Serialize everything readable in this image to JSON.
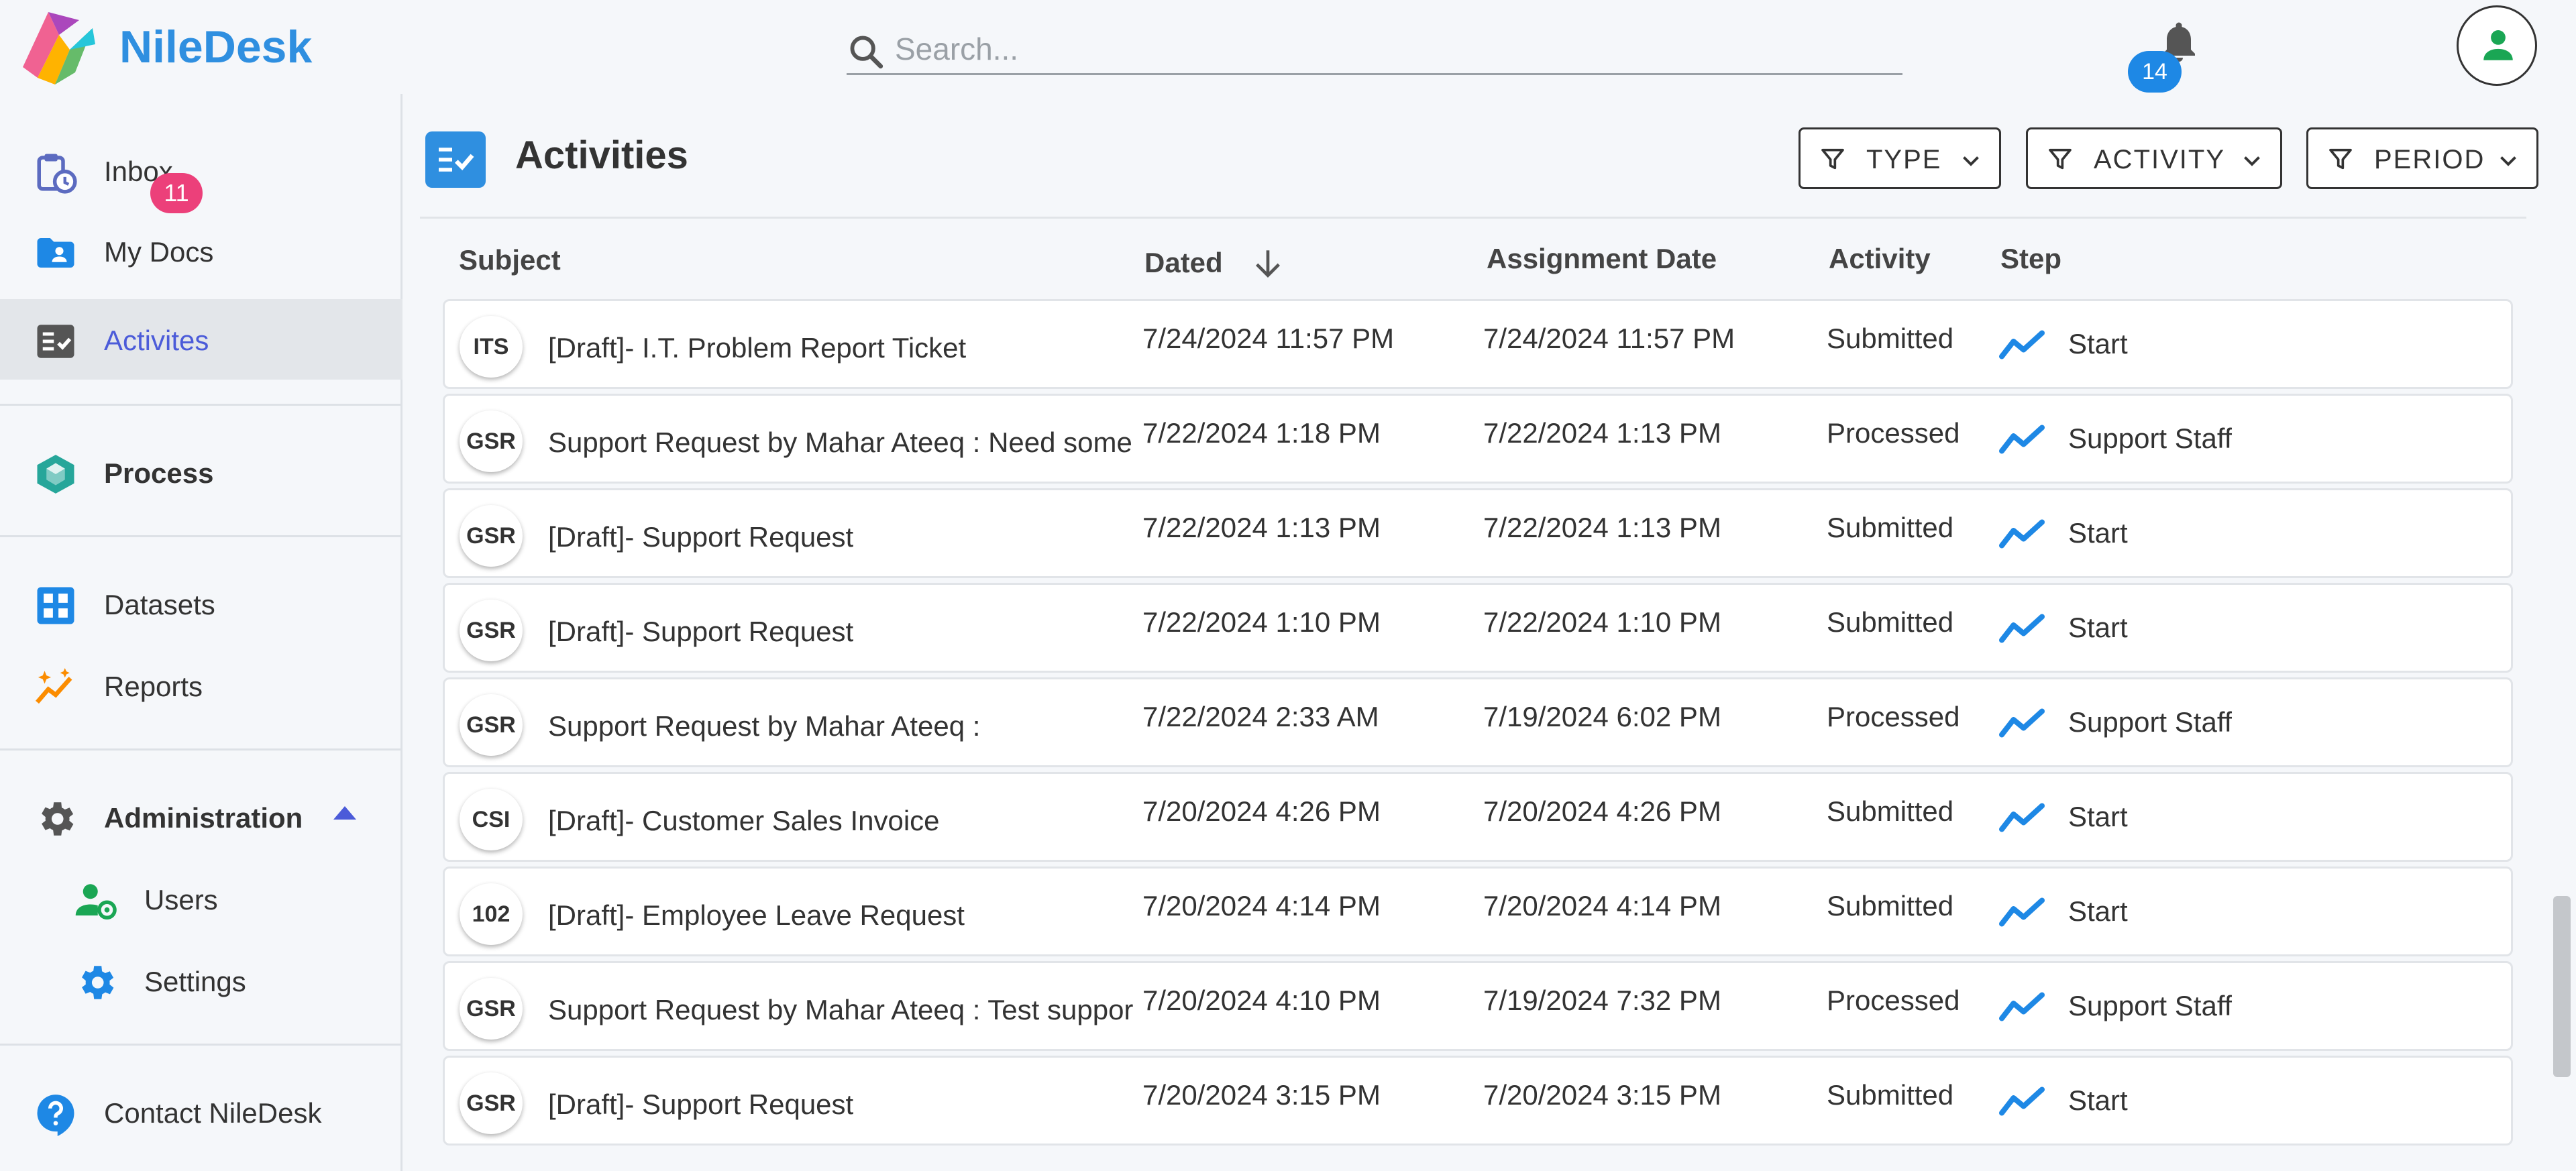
{
  "header": {
    "brand": "NileDesk",
    "search_placeholder": "Search...",
    "notification_count": "14"
  },
  "sidebar": {
    "items": [
      {
        "label": "Inbox",
        "icon": "clipboard-clock-icon",
        "badge": "11"
      },
      {
        "label": "My Docs",
        "icon": "folder-user-icon"
      },
      {
        "label": "Activites",
        "icon": "checklist-icon"
      },
      {
        "label": "Process",
        "icon": "cube-icon"
      },
      {
        "label": "Datasets",
        "icon": "grid-icon"
      },
      {
        "label": "Reports",
        "icon": "sparkle-chart-icon"
      },
      {
        "label": "Administration",
        "icon": "gear-icon"
      },
      {
        "label": "Users",
        "icon": "user-gear-icon"
      },
      {
        "label": "Settings",
        "icon": "gear-icon"
      },
      {
        "label": "Contact NileDesk",
        "icon": "help-chat-icon"
      }
    ]
  },
  "page": {
    "title": "Activities",
    "filters": [
      {
        "label": "TYPE"
      },
      {
        "label": "ACTIVITY"
      },
      {
        "label": "PERIOD"
      }
    ]
  },
  "table": {
    "columns": [
      "Subject",
      "Dated",
      "Assignment Date",
      "Activity",
      "Step"
    ],
    "rows": [
      {
        "code": "ITS",
        "subject": "[Draft]- I.T. Problem Report Ticket",
        "dated": "7/24/2024 11:57 PM",
        "assignment": "7/24/2024 11:57 PM",
        "activity": "Submitted",
        "step": "Start"
      },
      {
        "code": "GSR",
        "subject": "Support Request by Mahar Ateeq : Need some",
        "dated": "7/22/2024 1:18 PM",
        "assignment": "7/22/2024 1:13 PM",
        "activity": "Processed",
        "step": "Support Staff"
      },
      {
        "code": "GSR",
        "subject": "[Draft]- Support Request",
        "dated": "7/22/2024 1:13 PM",
        "assignment": "7/22/2024 1:13 PM",
        "activity": "Submitted",
        "step": "Start"
      },
      {
        "code": "GSR",
        "subject": "[Draft]- Support Request",
        "dated": "7/22/2024 1:10 PM",
        "assignment": "7/22/2024 1:10 PM",
        "activity": "Submitted",
        "step": "Start"
      },
      {
        "code": "GSR",
        "subject": "Support Request by Mahar Ateeq :",
        "dated": "7/22/2024 2:33 AM",
        "assignment": "7/19/2024 6:02 PM",
        "activity": "Processed",
        "step": "Support Staff"
      },
      {
        "code": "CSI",
        "subject": "[Draft]- Customer Sales Invoice",
        "dated": "7/20/2024 4:26 PM",
        "assignment": "7/20/2024 4:26 PM",
        "activity": "Submitted",
        "step": "Start"
      },
      {
        "code": "102",
        "subject": "[Draft]- Employee Leave Request",
        "dated": "7/20/2024 4:14 PM",
        "assignment": "7/20/2024 4:14 PM",
        "activity": "Submitted",
        "step": "Start"
      },
      {
        "code": "GSR",
        "subject": "Support Request by Mahar Ateeq : Test suppor",
        "dated": "7/20/2024 4:10 PM",
        "assignment": "7/19/2024 7:32 PM",
        "activity": "Processed",
        "step": "Support Staff"
      },
      {
        "code": "GSR",
        "subject": "[Draft]- Support Request",
        "dated": "7/20/2024 3:15 PM",
        "assignment": "7/20/2024 3:15 PM",
        "activity": "Submitted",
        "step": "Start"
      }
    ]
  },
  "colors": {
    "brand": "#2f8fe0",
    "active_nav": "#4b5bd9",
    "inbox_badge": "#ec407a",
    "notification_badge": "#1e88e5"
  }
}
